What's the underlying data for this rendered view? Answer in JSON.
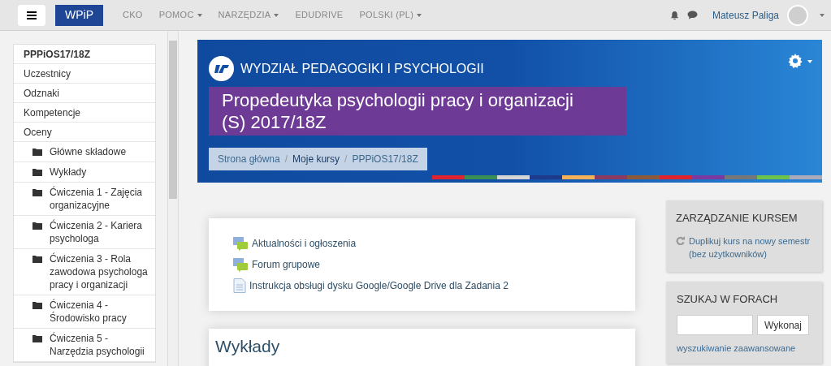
{
  "navbar": {
    "brand": "WPiP",
    "menu": [
      {
        "label": "CKO",
        "dropdown": false
      },
      {
        "label": "POMOC",
        "dropdown": true
      },
      {
        "label": "NARZĘDZIA",
        "dropdown": true
      },
      {
        "label": "EDUDRIVE",
        "dropdown": false
      },
      {
        "label": "POLSKI (PL)",
        "dropdown": true
      }
    ],
    "user": "Mateusz Paliga"
  },
  "sidebar": {
    "title": "PPPiOS17/18Z",
    "items": [
      {
        "kind": "link",
        "label": "Uczestnicy"
      },
      {
        "kind": "link",
        "label": "Odznaki"
      },
      {
        "kind": "link",
        "label": "Kompetencje"
      },
      {
        "kind": "link",
        "label": "Oceny"
      },
      {
        "kind": "folder",
        "label": "Główne składowe"
      },
      {
        "kind": "folder",
        "label": "Wykłady"
      },
      {
        "kind": "folder",
        "label": "Ćwiczenia 1 - Zajęcia organizacyjne"
      },
      {
        "kind": "folder",
        "label": "Ćwiczenia 2 - Kariera psychologa"
      },
      {
        "kind": "folder",
        "label": "Ćwiczenia 3 - Rola zawodowa psychologa pracy i organizacji"
      },
      {
        "kind": "folder",
        "label": "Ćwiczenia 4 - Środowisko pracy"
      },
      {
        "kind": "folder",
        "label": "Ćwiczenia 5 - Narzędzia psychologii"
      }
    ]
  },
  "banner": {
    "faculty": "WYDZIAŁ PEDAGOGIKI I PSYCHOLOGII",
    "course_title": "Propedeutyka psychologii pracy i organizacji (S) 2017/18Z",
    "breadcrumb_separator": "/",
    "breadcrumb": [
      "Strona główna",
      "Moje kursy",
      "PPPiOS17/18Z"
    ]
  },
  "activities": [
    {
      "kind": "forum",
      "label": "Aktualności i ogłoszenia"
    },
    {
      "kind": "forum",
      "label": "Forum grupowe"
    },
    {
      "kind": "file",
      "label": "Instrukcja obsługi dysku Google/Google Drive dla Zadania 2"
    }
  ],
  "section": {
    "title": "Wykłady"
  },
  "blocks": {
    "course_admin": {
      "title": "ZARZĄDZANIE KURSEM",
      "link": "Duplikuj kurs na nowy semestr (bez użytkowników)"
    },
    "forum_search": {
      "title": "SZUKAJ W FORACH",
      "button": "Wykonaj",
      "advanced": "wyszukiwanie zaawansowane"
    }
  }
}
